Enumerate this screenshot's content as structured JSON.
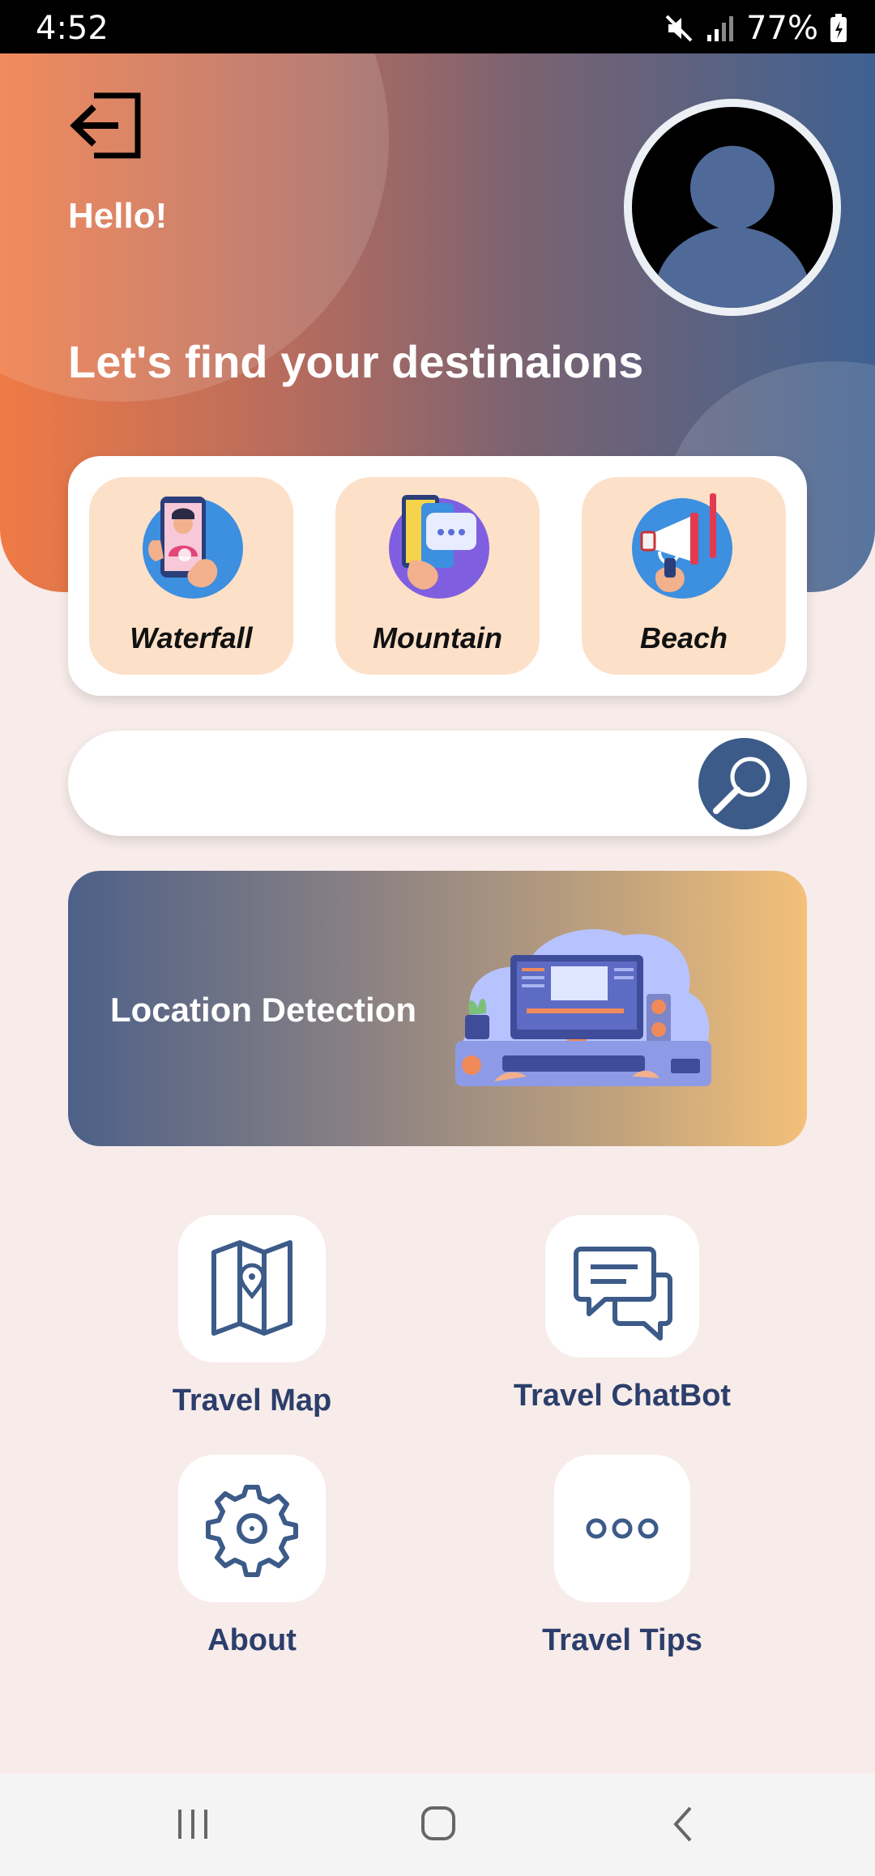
{
  "status_bar": {
    "time": "4:52",
    "battery": "77%"
  },
  "header": {
    "greeting": "Hello!",
    "headline": "Let's find your destinaions"
  },
  "categories": [
    {
      "label": "Waterfall"
    },
    {
      "label": "Mountain"
    },
    {
      "label": "Beach"
    }
  ],
  "search": {
    "placeholder": "",
    "value": ""
  },
  "banner": {
    "label": "Location Detection"
  },
  "menu": [
    {
      "label": "Travel Map"
    },
    {
      "label": "Travel ChatBot"
    },
    {
      "label": "About"
    },
    {
      "label": "Travel Tips"
    }
  ],
  "colors": {
    "accent": "#3c5b89",
    "label": "#2c3e6b",
    "tile": "#fde0c8"
  }
}
